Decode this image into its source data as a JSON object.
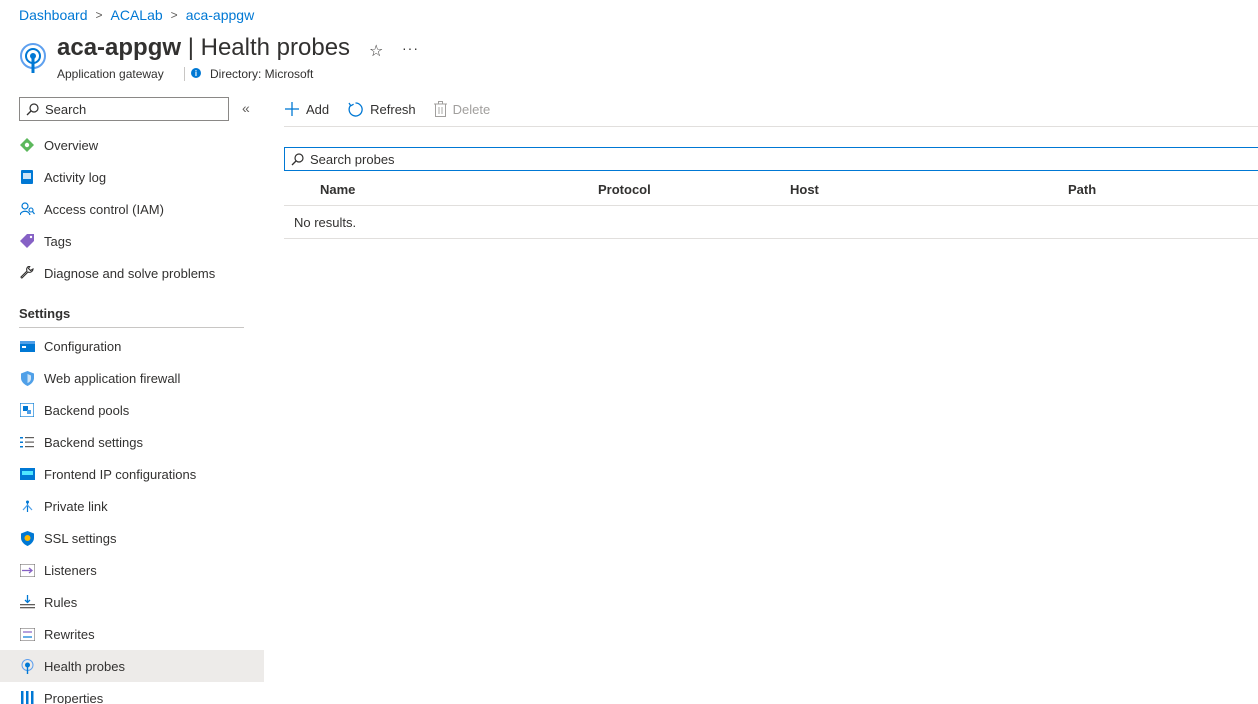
{
  "breadcrumb": [
    "Dashboard",
    "ACALab",
    "aca-appgw"
  ],
  "header": {
    "resource_name": "aca-appgw",
    "separator": "|",
    "page_name": "Health probes",
    "resource_type": "Application gateway",
    "directory": "Directory: Microsoft",
    "star_icon": "star-icon",
    "more_icon": "more-icon"
  },
  "sidebar": {
    "search_placeholder": "Search",
    "top_items": [
      {
        "label": "Overview",
        "icon": "overview-icon"
      },
      {
        "label": "Activity log",
        "icon": "activity-log-icon"
      },
      {
        "label": "Access control (IAM)",
        "icon": "iam-icon"
      },
      {
        "label": "Tags",
        "icon": "tag-icon"
      },
      {
        "label": "Diagnose and solve problems",
        "icon": "wrench-icon"
      }
    ],
    "section_label": "Settings",
    "settings_items": [
      {
        "label": "Configuration",
        "icon": "configuration-icon"
      },
      {
        "label": "Web application firewall",
        "icon": "shield-icon"
      },
      {
        "label": "Backend pools",
        "icon": "backend-pools-icon"
      },
      {
        "label": "Backend settings",
        "icon": "list-settings-icon"
      },
      {
        "label": "Frontend IP configurations",
        "icon": "frontend-ip-icon"
      },
      {
        "label": "Private link",
        "icon": "private-link-icon"
      },
      {
        "label": "SSL settings",
        "icon": "ssl-shield-icon"
      },
      {
        "label": "Listeners",
        "icon": "listeners-icon"
      },
      {
        "label": "Rules",
        "icon": "rules-icon"
      },
      {
        "label": "Rewrites",
        "icon": "rewrites-icon"
      },
      {
        "label": "Health probes",
        "icon": "health-probe-icon",
        "active": true
      },
      {
        "label": "Properties",
        "icon": "properties-icon"
      }
    ]
  },
  "toolbar": {
    "add_label": "Add",
    "refresh_label": "Refresh",
    "delete_label": "Delete"
  },
  "probes": {
    "search_placeholder": "Search probes",
    "columns": [
      "Name",
      "Protocol",
      "Host",
      "Path"
    ],
    "empty_message": "No results."
  },
  "colors": {
    "accent": "#0078d4",
    "active_nav_bg": "#edebe9",
    "text": "#323130",
    "disabled": "#a19f9d"
  }
}
